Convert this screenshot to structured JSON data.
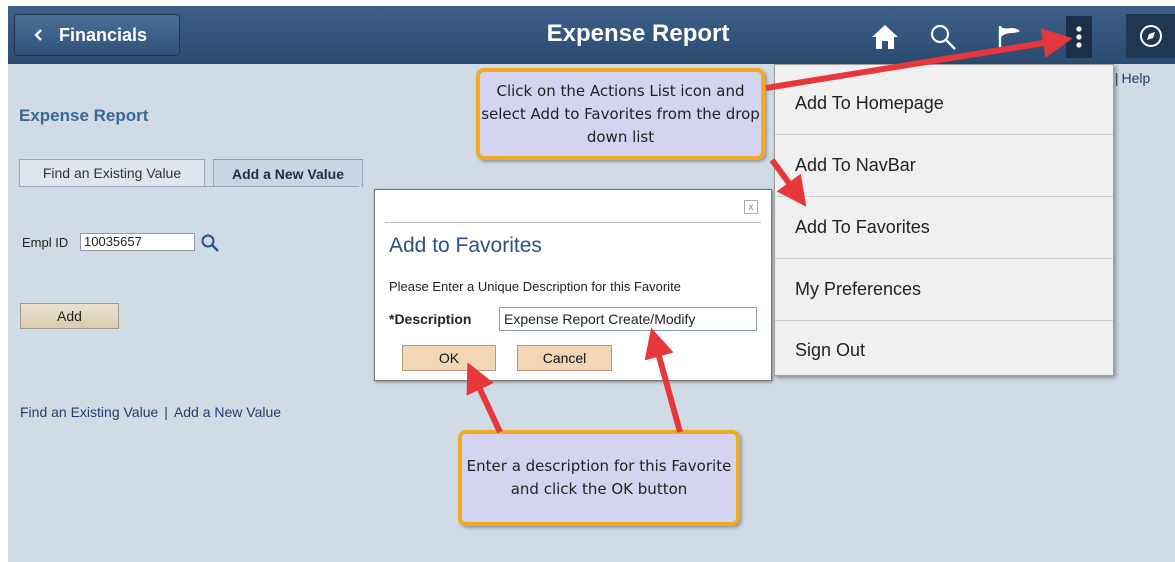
{
  "banner": {
    "back_label": "Financials",
    "title": "Expense Report"
  },
  "icons": {
    "back": "chevron-left-icon",
    "home": "home-icon",
    "search": "search-icon",
    "flag": "flag-icon",
    "actions": "actions-list-icon",
    "navigator": "compass-icon"
  },
  "topright": {
    "partial_link": "/",
    "help": "Help"
  },
  "page": {
    "heading": "Expense Report",
    "tabs": [
      "Find an Existing Value",
      "Add a New Value"
    ],
    "empl_label": "Empl ID",
    "empl_value": "10035657",
    "add_button": "Add",
    "bottom_links": [
      "Find an Existing Value",
      "Add a New Value"
    ]
  },
  "dialog": {
    "close_glyph": "x",
    "title": "Add to Favorites",
    "prompt": "Please Enter a Unique Description for this Favorite",
    "description_label": "*Description",
    "description_value": "Expense Report Create/Modify",
    "ok_label": "OK",
    "cancel_label": "Cancel"
  },
  "actions_menu": {
    "items": [
      "Add To Homepage",
      "Add To NavBar",
      "Add To Favorites",
      "My Preferences",
      "Sign Out"
    ]
  },
  "callouts": {
    "top": "Click on the Actions List icon and select Add to Favorites from the drop down list",
    "bottom": "Enter a description for this Favorite and click the OK button"
  },
  "colors": {
    "banner": "#2b4a70",
    "page_bg": "#d0dbe5",
    "callout_fill": "#d4d4f0",
    "callout_border": "#f2a923",
    "arrow": "#e8373a"
  }
}
